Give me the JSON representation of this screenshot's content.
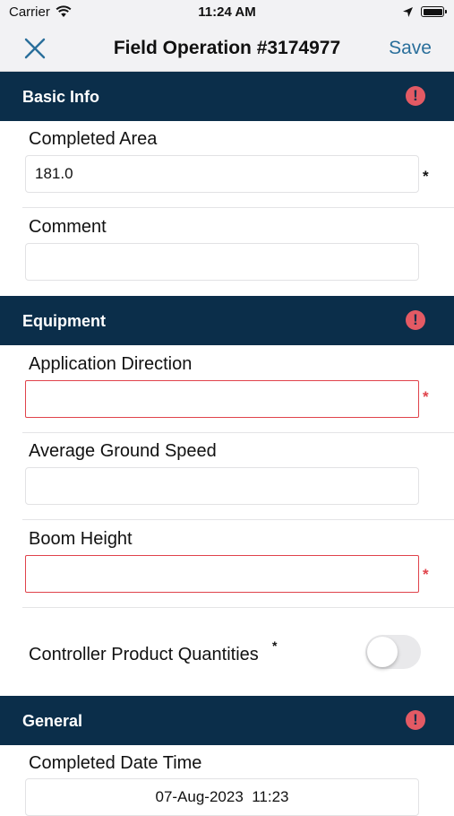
{
  "status_bar": {
    "carrier": "Carrier",
    "time": "11:24 AM"
  },
  "nav": {
    "title": "Field Operation #3174977",
    "save_label": "Save"
  },
  "sections": {
    "basic_info": {
      "title": "Basic Info"
    },
    "equipment": {
      "title": "Equipment"
    },
    "general": {
      "title": "General"
    }
  },
  "fields": {
    "completed_area": {
      "label": "Completed Area",
      "value": "181.0",
      "required_mark": "*"
    },
    "comment": {
      "label": "Comment",
      "value": ""
    },
    "application_direction": {
      "label": "Application Direction",
      "value": "",
      "required_mark": "*"
    },
    "average_ground_speed": {
      "label": "Average Ground Speed",
      "value": ""
    },
    "boom_height": {
      "label": "Boom Height",
      "value": "",
      "required_mark": "*"
    },
    "controller_product_quantities": {
      "label": "Controller Product Quantities",
      "required_mark": "*",
      "enabled": false
    },
    "completed_date_time": {
      "label": "Completed Date Time",
      "value": "07-Aug-2023  11:23"
    }
  },
  "colors": {
    "header_bg": "#0b2e4a",
    "accent": "#2a6f9b",
    "error": "#e0434b",
    "alert_icon": "#e35a64"
  },
  "icons": [
    "wifi-icon",
    "location-arrow-icon",
    "battery-icon",
    "close-icon",
    "alert-icon"
  ]
}
